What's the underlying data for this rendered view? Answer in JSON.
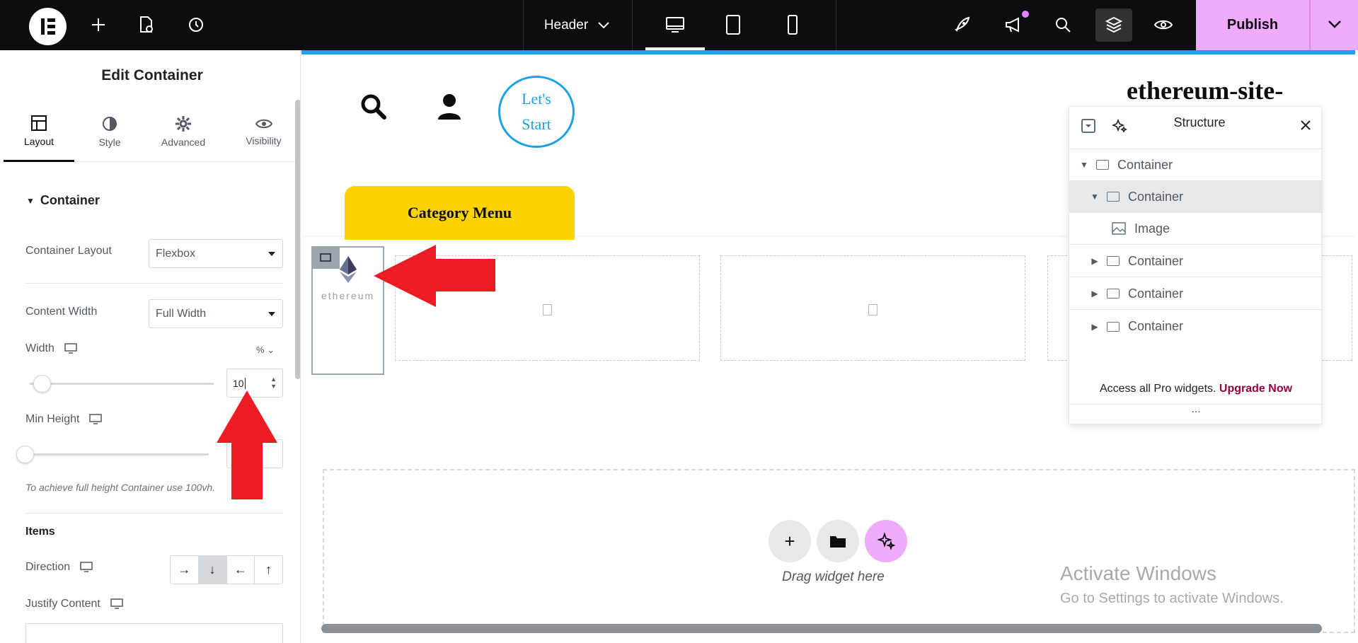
{
  "topbar": {
    "document_select": "Header",
    "publish_label": "Publish",
    "icons": [
      "elementor-logo-icon",
      "add-element-icon",
      "page-settings-icon",
      "history-icon",
      "chevron-down-icon",
      "desktop-icon",
      "tablet-icon",
      "mobile-icon",
      "rocket-icon",
      "megaphone-icon",
      "search-icon",
      "layers-icon",
      "preview-eye-icon"
    ],
    "accent_color": "#f0abfc"
  },
  "panel": {
    "title": "Edit Container",
    "tabs": [
      {
        "label": "Layout",
        "active": true
      },
      {
        "label": "Style",
        "active": false
      },
      {
        "label": "Advanced",
        "active": false
      },
      {
        "label": "Visibility",
        "active": false
      }
    ],
    "section": "Container",
    "container_layout": {
      "label": "Container Layout",
      "value": "Flexbox"
    },
    "content_width": {
      "label": "Content Width",
      "value": "Full Width"
    },
    "width": {
      "label": "Width",
      "unit": "%",
      "value": "10"
    },
    "min_height": {
      "label": "Min Height"
    },
    "hint": "To achieve full height Container use 100vh.",
    "items_heading": "Items",
    "direction": {
      "label": "Direction",
      "options": [
        "→",
        "↓",
        "←",
        "↑"
      ],
      "selected": "↓"
    },
    "justify_content": {
      "label": "Justify Content"
    }
  },
  "canvas": {
    "lets_start": [
      "Let's",
      "Start"
    ],
    "site_title": "ethereum-site-",
    "category_menu": "Category Menu",
    "logo_text": "ethereum",
    "drag_text": "Drag widget here",
    "watermark_title": "Activate Windows",
    "watermark_sub": "Go to Settings to activate Windows.",
    "accent_color": "#1ca2e8",
    "menu_color": "#fcd200"
  },
  "structure": {
    "title": "Structure",
    "items": [
      {
        "label": "Container",
        "level": 0,
        "expanded": true,
        "selected": false
      },
      {
        "label": "Container",
        "level": 1,
        "expanded": true,
        "selected": true
      },
      {
        "label": "Image",
        "level": 2,
        "expanded": null,
        "selected": false
      },
      {
        "label": "Container",
        "level": 1,
        "expanded": false,
        "selected": false
      },
      {
        "label": "Container",
        "level": 1,
        "expanded": false,
        "selected": false
      },
      {
        "label": "Container",
        "level": 1,
        "expanded": false,
        "selected": false
      }
    ],
    "pro_text": "Access all Pro widgets.",
    "pro_link": "Upgrade Now",
    "more": "..."
  }
}
